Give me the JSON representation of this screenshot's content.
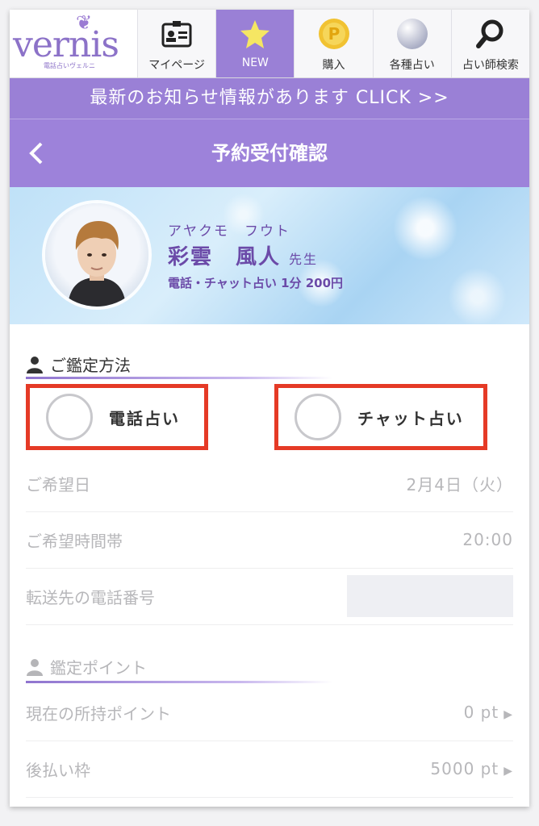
{
  "nav": {
    "logo_text": "vernis",
    "logo_sub": "電話占いヴェルニ",
    "items": [
      {
        "label": "マイページ",
        "icon": "id-card-icon"
      },
      {
        "label": "NEW",
        "icon": "star-icon"
      },
      {
        "label": "購入",
        "icon": "coin-icon"
      },
      {
        "label": "各種占い",
        "icon": "crystal-ball-icon"
      },
      {
        "label": "占い師検索",
        "icon": "search-icon"
      }
    ]
  },
  "notice": {
    "text": "最新のお知らせ情報があります CLICK >>"
  },
  "header": {
    "title": "予約受付確認"
  },
  "profile": {
    "kana": "アヤクモ　フウト",
    "name": "彩雲　風人",
    "honorific": "先生",
    "rate": "電話・チャット占い 1分 200円"
  },
  "method": {
    "title": "ご鑑定方法",
    "options": [
      {
        "label": "電話占い"
      },
      {
        "label": "チャット占い"
      }
    ]
  },
  "details": {
    "date_label": "ご希望日",
    "date_value": "2月4日（火）",
    "time_label": "ご希望時間帯",
    "time_value": "20:00",
    "phone_label": "転送先の電話番号"
  },
  "points": {
    "title": "鑑定ポイント",
    "current_label": "現在の所持ポイント",
    "current_value": "0 pt",
    "deferred_label": "後払い枠",
    "deferred_value": "5000 pt"
  },
  "colors": {
    "accent": "#9a80d6",
    "highlight": "#e53a26",
    "text_purple": "#6b4aa8"
  }
}
